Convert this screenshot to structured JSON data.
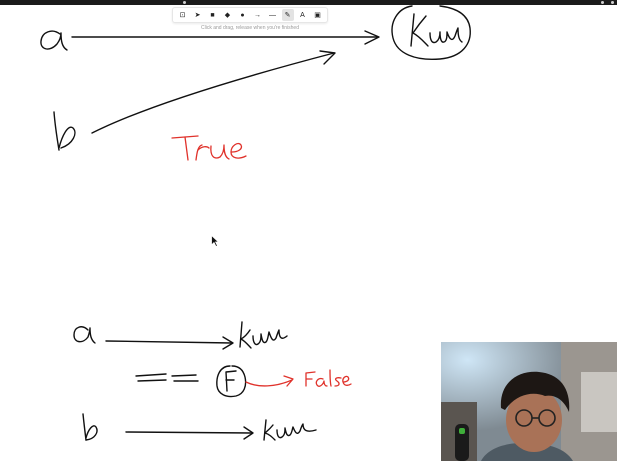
{
  "toolbar": {
    "hint": "Click and drag, release when you're finished",
    "tools": [
      {
        "name": "lock-icon",
        "glyph": "⊡"
      },
      {
        "name": "pointer-icon",
        "glyph": "➤"
      },
      {
        "name": "rectangle-icon",
        "glyph": "■"
      },
      {
        "name": "diamond-icon",
        "glyph": "◆"
      },
      {
        "name": "ellipse-icon",
        "glyph": "●"
      },
      {
        "name": "arrow-icon",
        "glyph": "→"
      },
      {
        "name": "line-icon",
        "glyph": "—"
      },
      {
        "name": "pencil-icon",
        "glyph": "✎"
      },
      {
        "name": "text-icon",
        "glyph": "A"
      },
      {
        "name": "image-icon",
        "glyph": "▣"
      }
    ],
    "active_tool": "pencil-icon"
  },
  "sketch": {
    "top_a": "a",
    "top_b": "b",
    "top_target": "Kum",
    "result_true": "True",
    "bottom_a": "a",
    "bottom_b": "b",
    "bottom_target_a": "kum",
    "bottom_target_b": "kum",
    "compare_op": "==",
    "false_mark": "F",
    "result_false": "False"
  },
  "colors": {
    "ink": "#111111",
    "red_ink": "#e0322b",
    "toolbar_active": "#e3e3e3"
  }
}
